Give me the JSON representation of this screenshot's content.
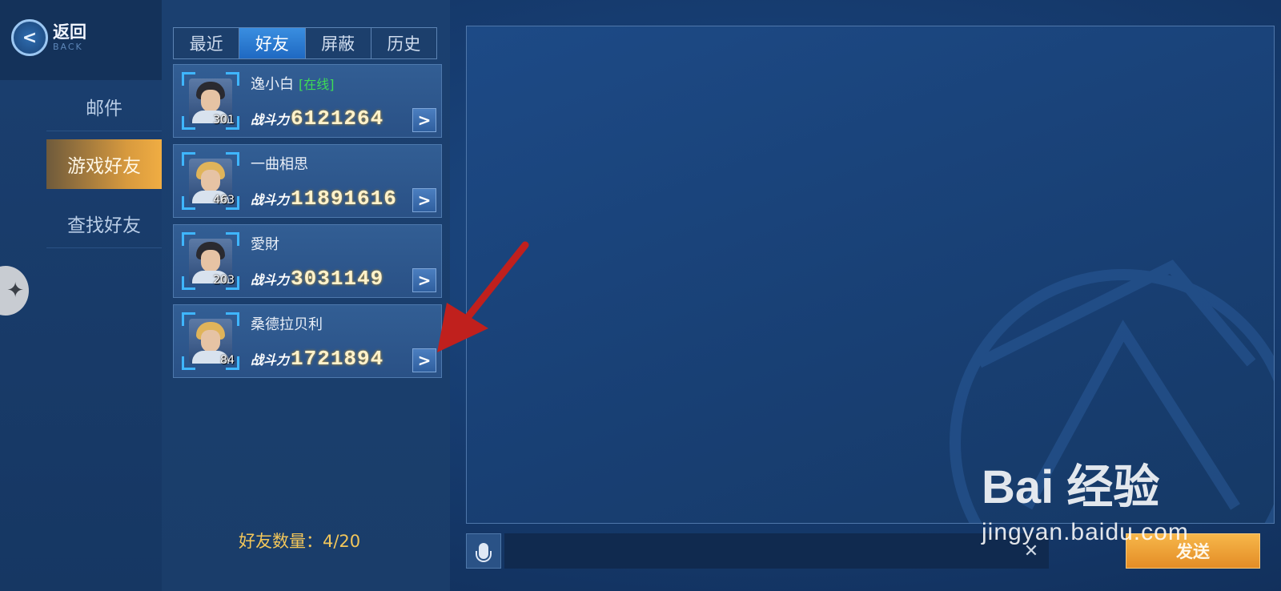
{
  "header": {
    "back_label": "返回",
    "back_sub": "BACK"
  },
  "nav": {
    "items": [
      {
        "label": "邮件"
      },
      {
        "label": "游戏好友"
      },
      {
        "label": "查找好友"
      }
    ]
  },
  "tabs": [
    {
      "label": "最近"
    },
    {
      "label": "好友"
    },
    {
      "label": "屏蔽"
    },
    {
      "label": "历史"
    }
  ],
  "power_label": "战斗力",
  "friends": [
    {
      "name": "逸小白",
      "status": "[在线]",
      "level": "301",
      "power": "6121264",
      "hair": "#2a2a30"
    },
    {
      "name": "一曲相思",
      "status": "",
      "level": "463",
      "power": "11891616",
      "hair": "#e0b45a"
    },
    {
      "name": "愛財",
      "status": "",
      "level": "203",
      "power": "3031149",
      "hair": "#2a2a30"
    },
    {
      "name": "桑德拉贝利",
      "status": "",
      "level": "84",
      "power": "1721894",
      "hair": "#e0b45a"
    }
  ],
  "friend_count": "好友数量：4/20",
  "chat": {
    "input_value": "",
    "send_label": "发送"
  },
  "watermark": {
    "main": "Bai 经验",
    "sub": "jingyan.baidu.com"
  },
  "colors": {
    "accent_orange": "#e48d26",
    "online_green": "#3edc55",
    "annotation_red": "#c0201d"
  }
}
